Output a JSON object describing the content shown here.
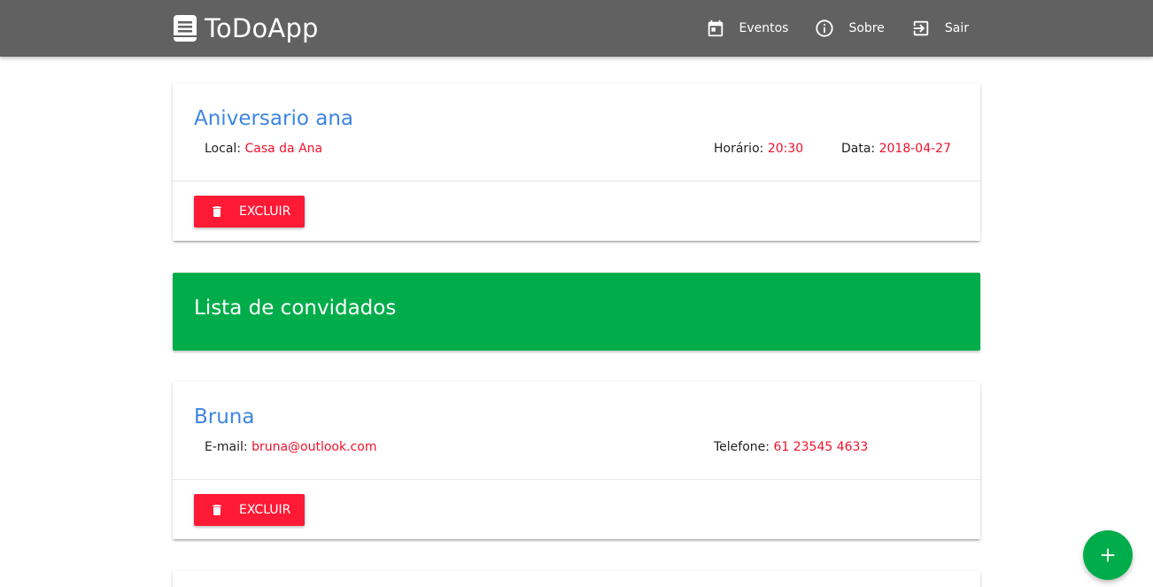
{
  "navbar": {
    "brand": "ToDoApp",
    "links": [
      {
        "label": "Eventos",
        "icon": "calendar-icon"
      },
      {
        "label": "Sobre",
        "icon": "info-icon"
      },
      {
        "label": "Sair",
        "icon": "exit-icon"
      }
    ]
  },
  "event": {
    "title": "Aniversario ana",
    "local_label": "Local:",
    "local_value": "Casa da Ana",
    "time_label": "Horário:",
    "time_value": "20:30",
    "date_label": "Data:",
    "date_value": "2018-04-27",
    "delete_label": "EXCLUIR"
  },
  "guests_banner": {
    "title": "Lista de convidados"
  },
  "guests": [
    {
      "name": "Bruna",
      "email_label": "E-mail:",
      "email_value": "bruna@outlook.com",
      "phone_label": "Telefone:",
      "phone_value": "61 23545 4633",
      "delete_label": "EXCLUIR"
    }
  ],
  "fab": {
    "icon": "plus-icon"
  },
  "colors": {
    "navbar": "#616161",
    "title_blue": "#3d85e0",
    "value_red": "#f0122d",
    "delete_red": "#ff1a35",
    "banner_green": "#00ad4a"
  }
}
